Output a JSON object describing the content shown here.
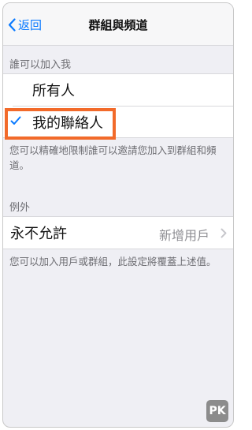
{
  "navbar": {
    "back_label": "返回",
    "title": "群組與頻道"
  },
  "who_can_add": {
    "header": "誰可以加入我",
    "options": [
      {
        "label": "所有人",
        "selected": false
      },
      {
        "label": "我的聯絡人",
        "selected": true
      }
    ],
    "footer": "您可以精確地限制誰可以邀請您加入到群組和頻道。"
  },
  "exceptions": {
    "header": "例外",
    "never_allow": {
      "label": "永不允許",
      "detail": "新增用戶"
    },
    "footer": "您可以加入用戶或群組，此設定將覆蓋上述值。"
  },
  "colors": {
    "accent": "#0a7aff",
    "highlight": "#f26a2a"
  },
  "watermark": "PK"
}
